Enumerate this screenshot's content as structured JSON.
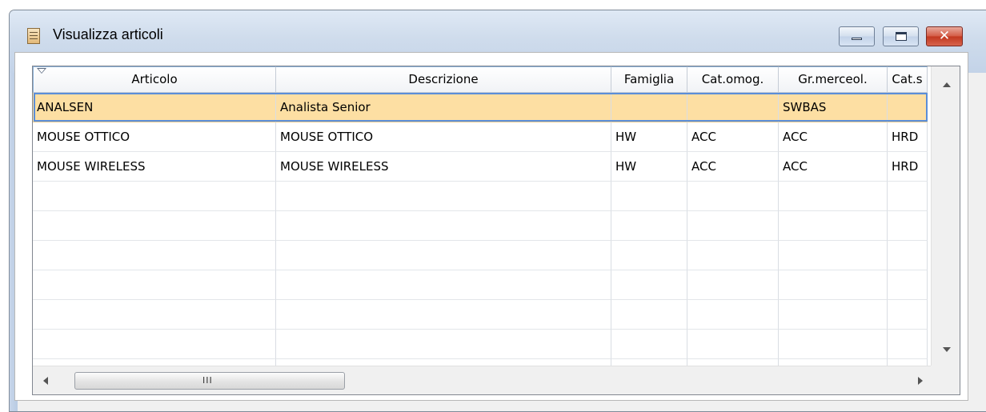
{
  "window": {
    "title": "Visualizza articoli",
    "controls": {
      "minimize_icon": "minimize-icon",
      "maximize_icon": "maximize-icon",
      "close_icon": "close-icon",
      "close_glyph": "✕"
    },
    "colors": {
      "close_button": "#c2371f",
      "selection_fill": "#fddfa3",
      "selection_border": "#5b8ed8"
    }
  },
  "grid": {
    "columns": [
      "Articolo",
      "Descrizione",
      "Famiglia",
      "Cat.omog.",
      "Gr.merceol.",
      "Cat.s"
    ],
    "rows": [
      [
        "ANALSEN",
        "Analista Senior",
        "",
        "",
        "SWBAS",
        ""
      ],
      [
        "MOUSE OTTICO",
        "MOUSE OTTICO",
        "HW",
        "ACC",
        "ACC",
        "HRD"
      ],
      [
        "MOUSE WIRELESS",
        "MOUSE WIRELESS",
        "HW",
        "ACC",
        "ACC",
        "HRD"
      ]
    ],
    "selected_row": 0,
    "scrollbar_grip": "III"
  }
}
